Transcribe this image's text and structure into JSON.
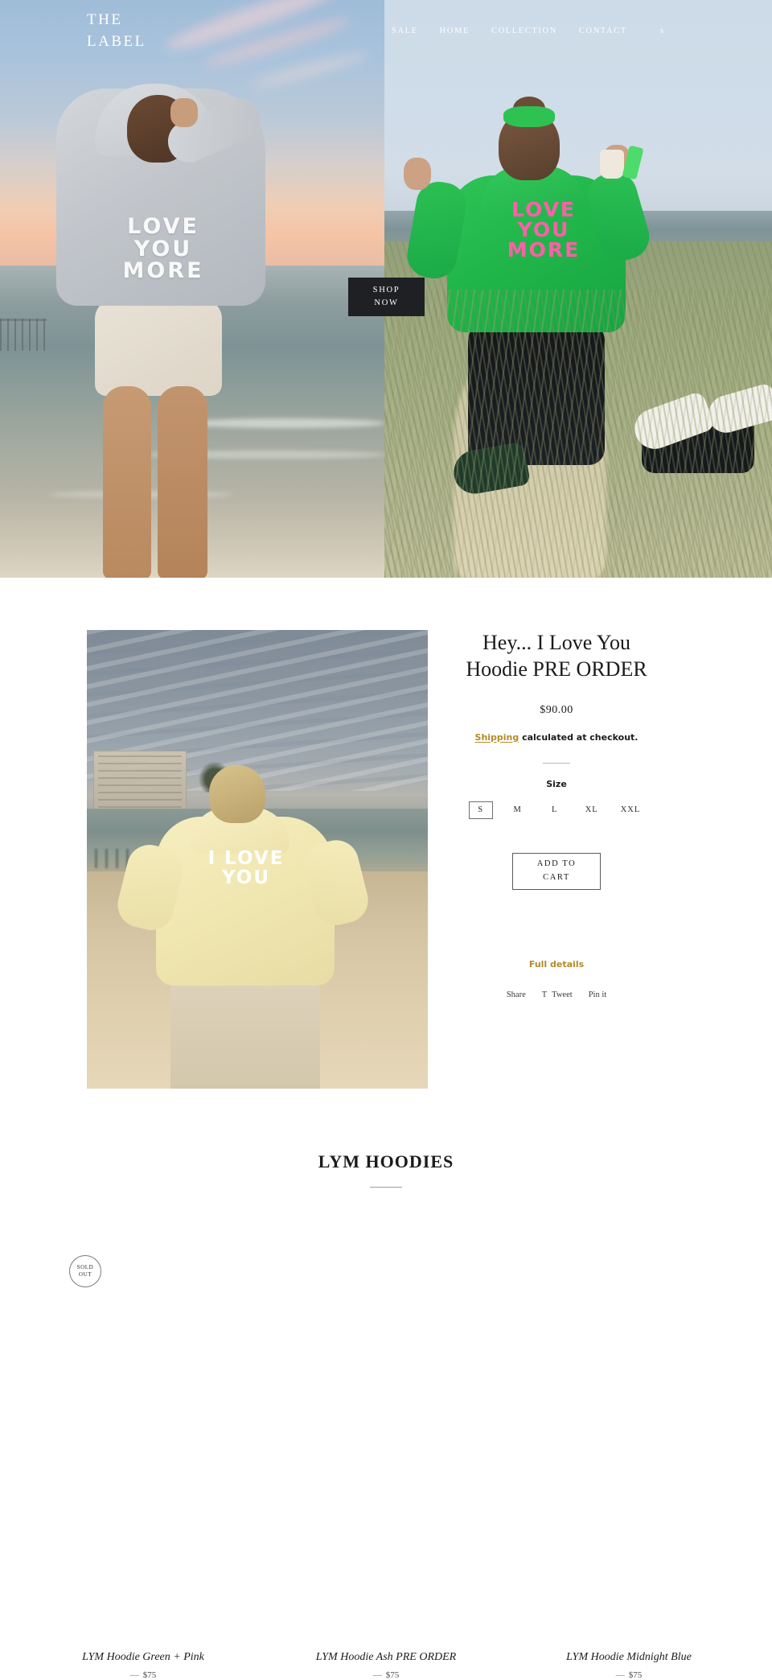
{
  "header": {
    "logo_line1": "THE",
    "logo_line2": "LABEL",
    "nav": [
      {
        "label": "SALE"
      },
      {
        "label": "HOME"
      },
      {
        "label": "COLLECTION"
      },
      {
        "label": "CONTACT"
      }
    ],
    "search_icon_label": "s",
    "search_icon_name": "search-icon"
  },
  "hero": {
    "shop_now_line1": "SHOP",
    "shop_now_line2": "NOW",
    "left_hoodie_text_l1": "LOVE",
    "left_hoodie_text_l2": "YOU",
    "left_hoodie_text_l3": "MORE",
    "right_hoodie_text_l1": "LOVE",
    "right_hoodie_text_l2": "YOU",
    "right_hoodie_text_l3": "MORE"
  },
  "product": {
    "title": "Hey... I Love You Hoodie PRE ORDER",
    "price": "$90.00",
    "shipping_link": "Shipping",
    "shipping_rest": " calculated at checkout.",
    "size_label": "Size",
    "sizes": [
      {
        "label": "S",
        "selected": true
      },
      {
        "label": "M",
        "selected": false
      },
      {
        "label": "L",
        "selected": false
      },
      {
        "label": "XL",
        "selected": false
      },
      {
        "label": "XXL",
        "selected": false
      }
    ],
    "add_to_cart_line1": "ADD TO",
    "add_to_cart_line2": "CART",
    "full_details": "Full details",
    "share": [
      {
        "label": "Share",
        "icon": ""
      },
      {
        "label": "Tweet",
        "icon": "T"
      },
      {
        "label": "Pin it",
        "icon": ""
      }
    ],
    "photo_hoodie_text_l1": "I LOVE",
    "photo_hoodie_text_l2": "YOU"
  },
  "collection": {
    "title": "LYM HOODIES",
    "products": [
      {
        "title": "LYM Hoodie Green + Pink",
        "price": "$75",
        "dash": "—",
        "sold_out": true,
        "sold_out_line1": "SOLD",
        "sold_out_line2": "OUT"
      },
      {
        "title": "LYM Hoodie Ash PRE ORDER",
        "price": "$75",
        "dash": "—",
        "sold_out": false
      },
      {
        "title": "LYM Hoodie Midnight Blue",
        "price": "$75",
        "dash": "—",
        "sold_out": false
      }
    ]
  },
  "colors": {
    "accent_gold": "#b38b27",
    "dark_button": "#1f2023",
    "hoodie_green": "#20b549",
    "hoodie_pink": "#ff5fa8"
  }
}
